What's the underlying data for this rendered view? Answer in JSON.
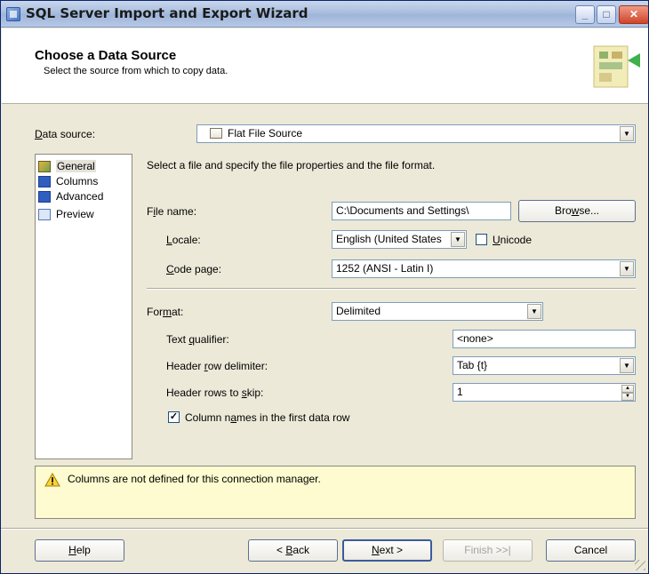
{
  "window": {
    "title": "SQL Server Import and Export Wizard",
    "controls": {
      "minimize": "_",
      "maximize": "□",
      "close": "✕"
    }
  },
  "header": {
    "title": "Choose a Data Source",
    "subtitle": "Select the source from which to copy data."
  },
  "data_source": {
    "label": "Data source:",
    "label_mnemonic": "D",
    "value": "Flat File Source"
  },
  "sidebar": {
    "items": [
      {
        "label": "General",
        "icon": "general-icon",
        "selected": true
      },
      {
        "label": "Columns",
        "icon": "columns-icon",
        "selected": false
      },
      {
        "label": "Advanced",
        "icon": "advanced-icon",
        "selected": false
      },
      {
        "label": "Preview",
        "icon": "preview-icon",
        "selected": false
      }
    ]
  },
  "general": {
    "instruction": "Select a file and specify the file properties and the file format.",
    "file_name_label": "File name:",
    "file_name_value": "C:\\Documents and Settings\\",
    "browse_label": "Browse...",
    "locale_label": "Locale:",
    "locale_value": "English (United States",
    "unicode_label": "Unicode",
    "unicode_checked": false,
    "code_page_label": "Code page:",
    "code_page_value": "1252  (ANSI - Latin I)",
    "format_label": "Format:",
    "format_value": "Delimited",
    "text_qualifier_label": "Text qualifier:",
    "text_qualifier_value": "<none>",
    "header_row_delimiter_label": "Header row delimiter:",
    "header_row_delimiter_value": "Tab {t}",
    "header_rows_skip_label": "Header rows to skip:",
    "header_rows_skip_value": "1",
    "column_names_label": "Column names in the first data row",
    "column_names_checked": true
  },
  "warning": {
    "text": "Columns are not defined for this connection manager."
  },
  "buttons": {
    "help": "Help",
    "back": "< Back",
    "next": "Next >",
    "finish": "Finish >>|",
    "cancel": "Cancel"
  }
}
